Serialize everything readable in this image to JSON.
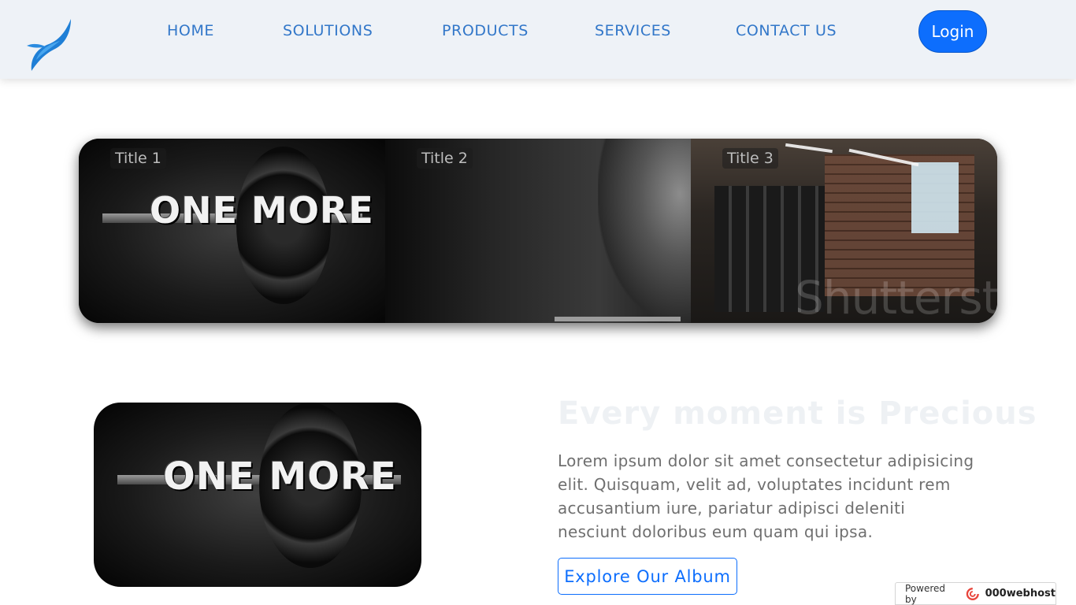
{
  "nav": {
    "links": [
      "HOME",
      "SOLUTIONS",
      "PRODUCTS",
      "SERVICES",
      "CONTACT US"
    ],
    "login_label": "Login"
  },
  "carousel": {
    "panels": [
      {
        "title": "Title 1",
        "caption": "ONE MORE"
      },
      {
        "title": "Title 2",
        "caption": ""
      },
      {
        "title": "Title 3",
        "caption": ""
      }
    ],
    "watermark": "Shutterst"
  },
  "album": {
    "image_caption": "ONE MORE",
    "heading": "Every moment is Precious",
    "paragraph": "Lorem ipsum dolor sit amet consectetur adipisicing elit. Quisquam, velit ad, voluptates incidunt rem accusantium iure, pariatur adipisci deleniti nesciunt doloribus eum quam qui ipsa.",
    "button_label": "Explore Our Album"
  },
  "footer_badge": {
    "powered_by": "Powered by",
    "brand": "000webhost"
  },
  "colors": {
    "nav_bg": "#eef2f7",
    "link": "#3277c9",
    "primary": "#0d6efd"
  }
}
